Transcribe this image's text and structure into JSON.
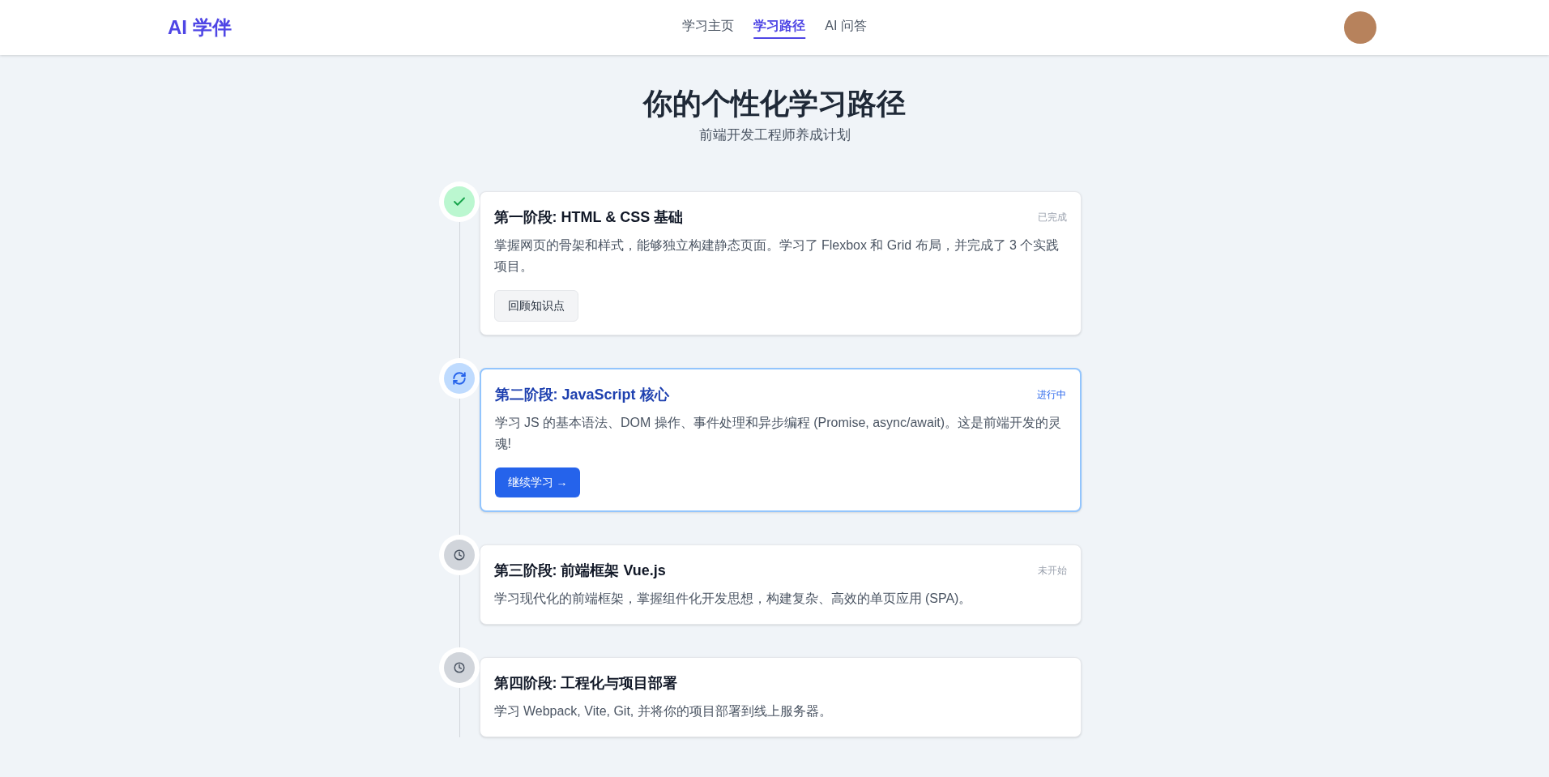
{
  "header": {
    "logo": "AI 学伴",
    "nav": [
      {
        "label": "学习主页",
        "selected": false
      },
      {
        "label": "学习路径",
        "selected": true
      },
      {
        "label": "AI 问答",
        "selected": false
      }
    ]
  },
  "title": "你的个性化学习路径",
  "subtitle": "前端开发工程师养成计划",
  "stages": [
    {
      "kind": "completed",
      "title": "第一阶段: HTML & CSS 基础",
      "badge": "已完成",
      "description": "掌握网页的骨架和样式，能够独立构建静态页面。学习了 Flexbox 和 Grid 布局，并完成了 3 个实践项目。",
      "button": {
        "kind": "secondary",
        "label": "回顾知识点"
      }
    },
    {
      "kind": "in_progress",
      "title": "第二阶段: JavaScript 核心",
      "badge": "进行中",
      "description": "学习 JS 的基本语法、DOM 操作、事件处理和异步编程 (Promise, async/await)。这是前端开发的灵魂!",
      "button": {
        "kind": "primary",
        "label": "继续学习 →"
      }
    },
    {
      "kind": "not_started",
      "title": "第三阶段: 前端框架 Vue.js",
      "badge": "未开始",
      "description": "学习现代化的前端框架，掌握组件化开发思想，构建复杂、高效的单页应用 (SPA)。"
    },
    {
      "kind": "not_started",
      "title": "第四阶段: 工程化与项目部署",
      "description": "学习 Webpack, Vite, Git, 并将你的项目部署到线上服务器。"
    }
  ]
}
